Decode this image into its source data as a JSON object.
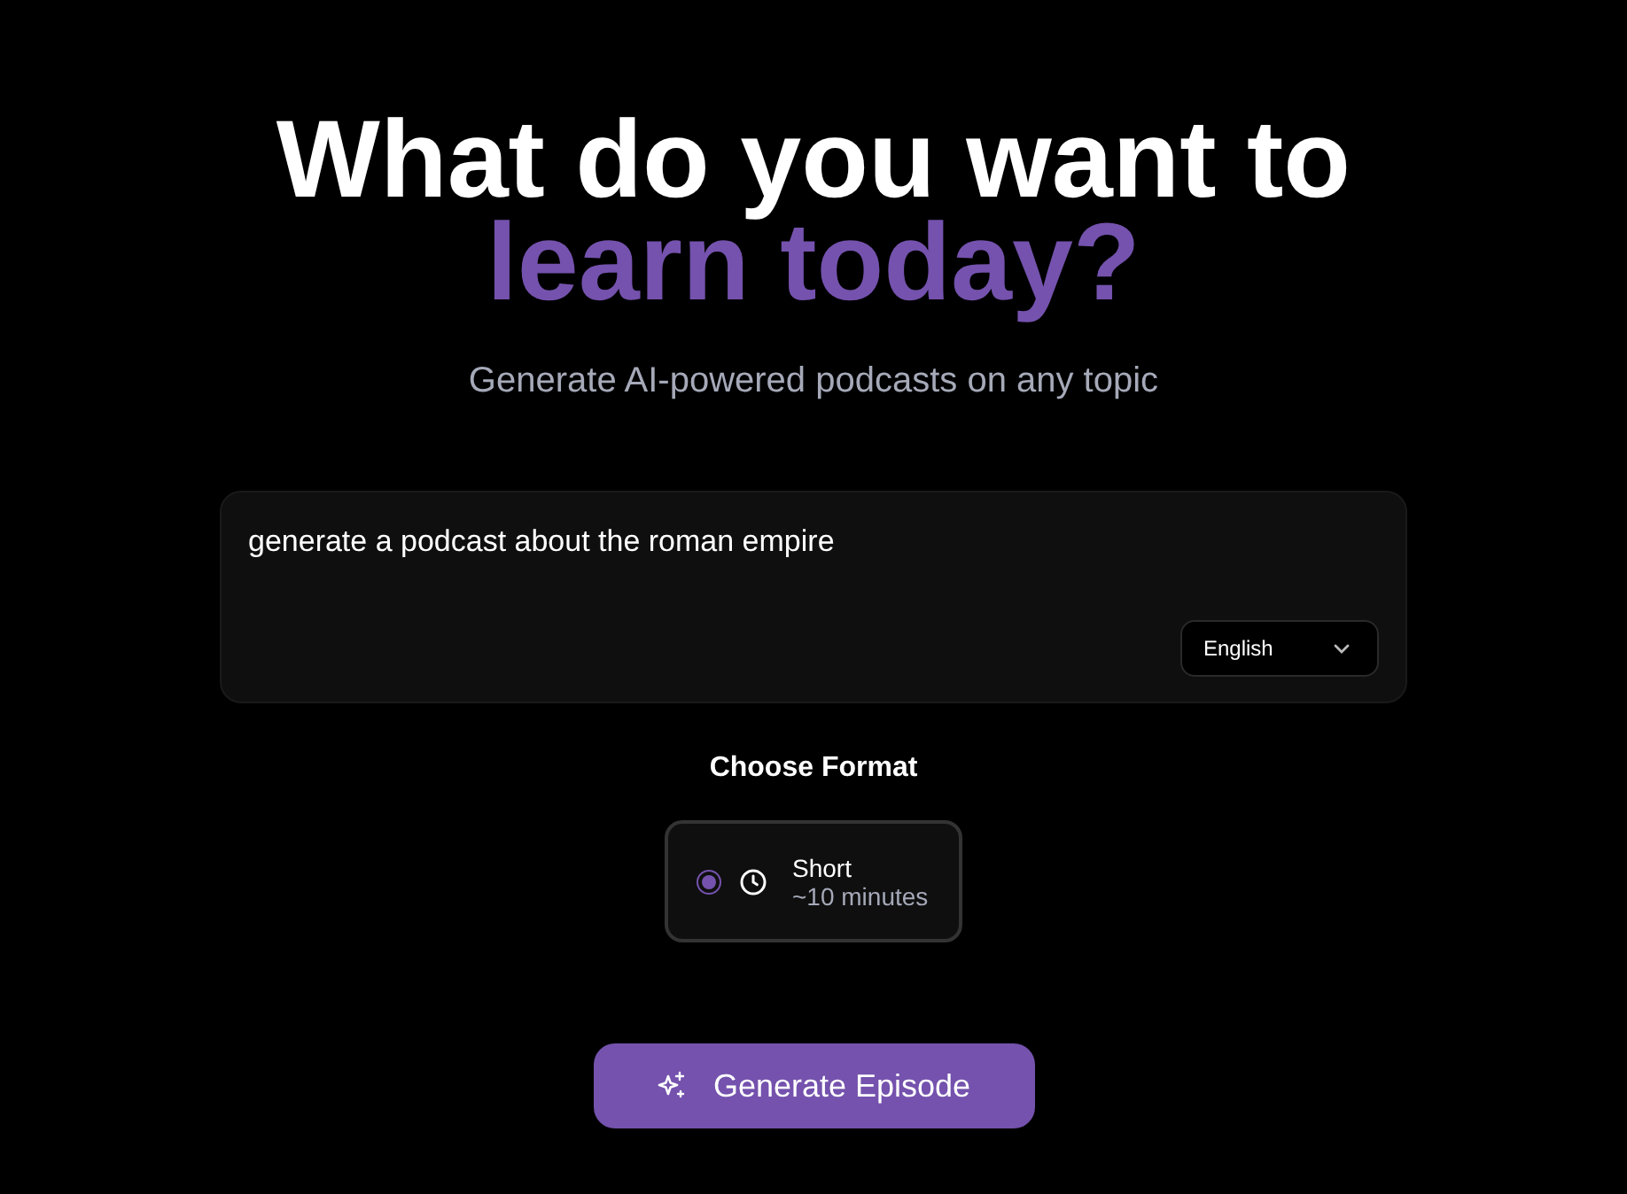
{
  "headline": {
    "line": "What do you want to",
    "highlight": "learn today?"
  },
  "subtitle": "Generate AI-powered podcasts on any topic",
  "prompt": {
    "value": "generate a podcast about the roman empire",
    "language": "English"
  },
  "format": {
    "heading": "Choose Format",
    "options": [
      {
        "title": "Short",
        "duration": "~10 minutes",
        "selected": true
      }
    ]
  },
  "button": "Generate Episode"
}
